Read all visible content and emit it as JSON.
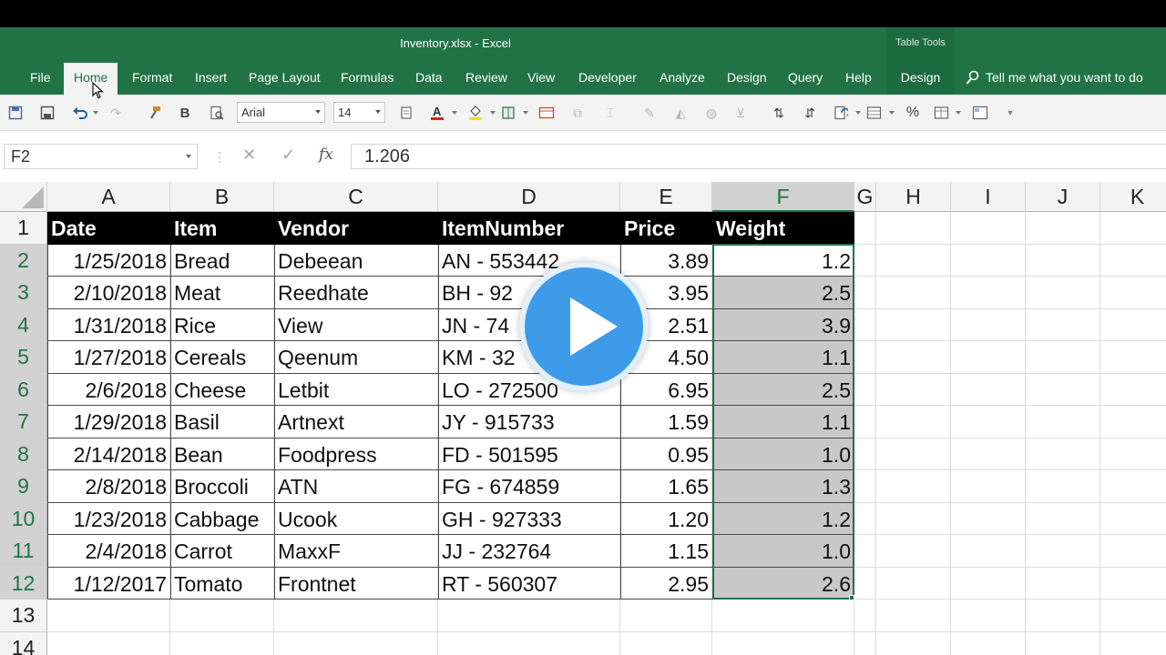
{
  "window": {
    "title": "Inventory.xlsx  -  Excel",
    "context_group": "Table Tools"
  },
  "ribbon": {
    "tabs": [
      "File",
      "Home",
      "Format",
      "Insert",
      "Page Layout",
      "Formulas",
      "Data",
      "Review",
      "View",
      "Developer",
      "Analyze",
      "Design",
      "Query",
      "Help",
      "Design"
    ],
    "active_tab": "Home",
    "tell_me": "Tell me what you want to do"
  },
  "toolbar": {
    "font_name": "Arial",
    "font_size": "14",
    "bold_label": "B",
    "percent_label": "%"
  },
  "formula_bar": {
    "name_box": "F2",
    "fx_label": "fx",
    "value": "1.206"
  },
  "sheet": {
    "columns": [
      "A",
      "B",
      "C",
      "D",
      "E",
      "F",
      "G",
      "H",
      "I",
      "J",
      "K"
    ],
    "rows": [
      "1",
      "2",
      "3",
      "4",
      "5",
      "6",
      "7",
      "8",
      "9",
      "10",
      "11",
      "12",
      "13",
      "14"
    ],
    "selected_column": "F",
    "table_headers": [
      "Date",
      "Item",
      "Vendor",
      "ItemNumber",
      "Price",
      "Weight"
    ],
    "table_rows": [
      [
        "1/25/2018",
        "Bread",
        "Debeean",
        "AN - 553442",
        "3.89",
        "1.2"
      ],
      [
        "2/10/2018",
        "Meat",
        "Reedhate",
        "BH - 92",
        "3.95",
        "2.5"
      ],
      [
        "1/31/2018",
        "Rice",
        "View",
        "JN - 74",
        "2.51",
        "3.9"
      ],
      [
        "1/27/2018",
        "Cereals",
        "Qeenum",
        "KM - 32",
        "4.50",
        "1.1"
      ],
      [
        "2/6/2018",
        "Cheese",
        "Letbit",
        "LO - 272500",
        "6.95",
        "2.5"
      ],
      [
        "1/29/2018",
        "Basil",
        "Artnext",
        "JY - 915733",
        "1.59",
        "1.1"
      ],
      [
        "2/14/2018",
        "Bean",
        "Foodpress",
        "FD - 501595",
        "0.95",
        "1.0"
      ],
      [
        "2/8/2018",
        "Broccoli",
        "ATN",
        "FG - 674859",
        "1.65",
        "1.3"
      ],
      [
        "1/23/2018",
        "Cabbage",
        "Ucook",
        "GH - 927333",
        "1.20",
        "1.2"
      ],
      [
        "2/4/2018",
        "Carrot",
        "MaxxF",
        "JJ - 232764",
        "1.15",
        "1.0"
      ],
      [
        "1/12/2017",
        "Tomato",
        "Frontnet",
        "RT - 560307",
        "2.95",
        "2.6"
      ]
    ]
  },
  "colors": {
    "excel_green": "#217346",
    "play_blue": "#3d9be9"
  },
  "overlay": {
    "icon": "play-icon"
  }
}
